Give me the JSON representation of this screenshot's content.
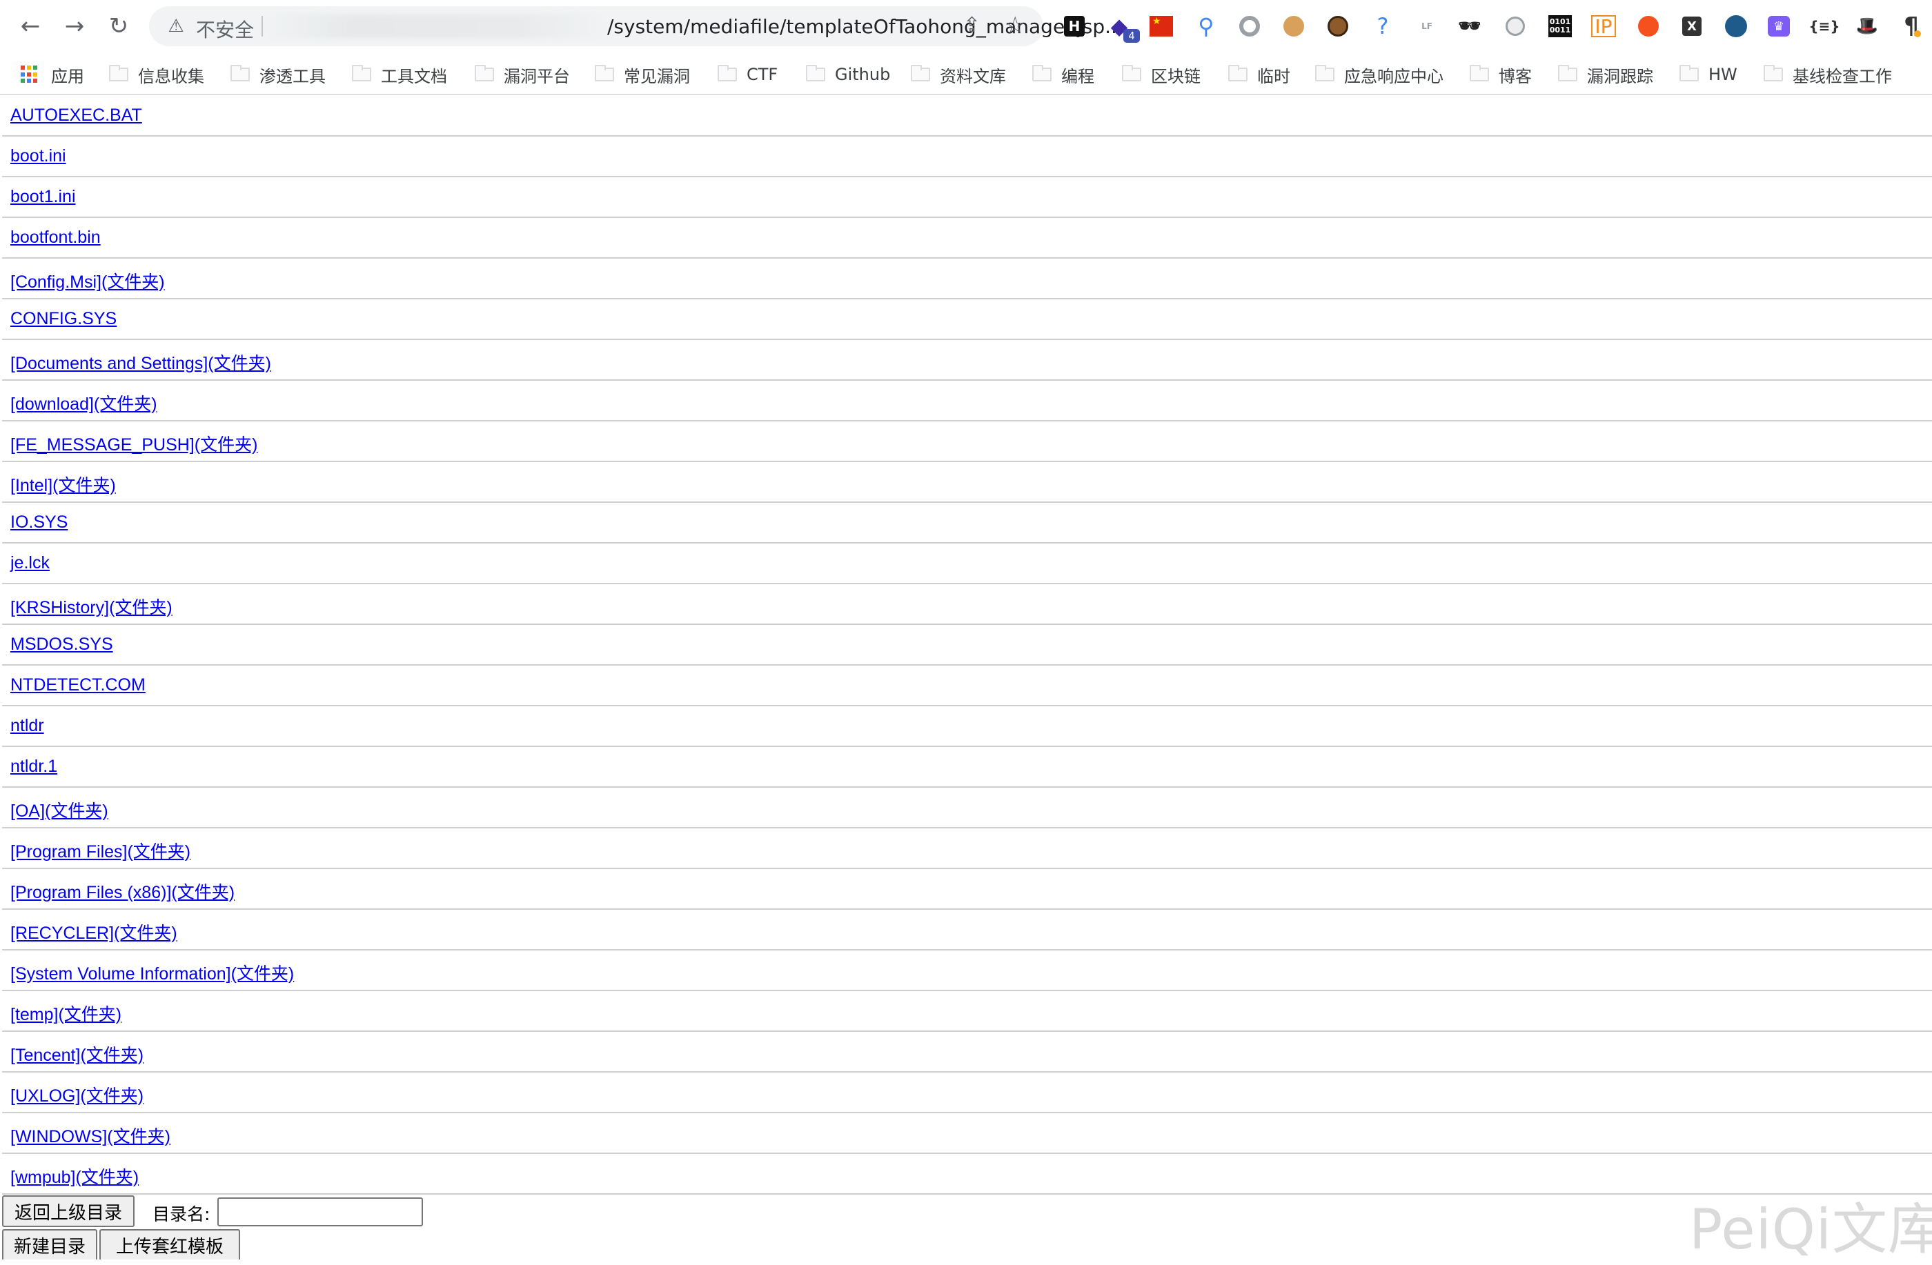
{
  "browser": {
    "back_icon": "arrow-left-icon",
    "forward_icon": "arrow-right-icon",
    "reload_icon": "reload-icon",
    "security_label": "不安全",
    "url_visible": "/system/mediafile/templateOfTaohong_manager.jsp...",
    "share_icon": "share-icon",
    "bookmark_star_icon": "star-icon",
    "extensions": [
      {
        "icon": "h-ext-icon",
        "text": "H"
      },
      {
        "icon": "stack-ext-icon",
        "text": "◆",
        "badge": "4"
      },
      {
        "icon": "china-flag-ext-icon",
        "text": "★"
      },
      {
        "icon": "map-pin-ext-icon",
        "text": "⚲"
      },
      {
        "icon": "gray-circle-ext-icon",
        "text": ""
      },
      {
        "icon": "cookie-ext-icon",
        "text": ""
      },
      {
        "icon": "cookie-dark-ext-icon",
        "text": ""
      },
      {
        "icon": "question-ext-icon",
        "text": "?"
      },
      {
        "icon": "lf-ext-icon",
        "text": "LF"
      },
      {
        "icon": "mask-ext-icon",
        "text": "🕶"
      },
      {
        "icon": "globe-ext-icon",
        "text": ""
      },
      {
        "icon": "binary-ext-icon",
        "text": "0101 0011"
      },
      {
        "icon": "ip-ext-icon",
        "text": "IP"
      },
      {
        "icon": "orange-ext-icon",
        "text": ""
      },
      {
        "icon": "x-ext-icon",
        "text": "X"
      },
      {
        "icon": "blue-ext-icon",
        "text": ""
      },
      {
        "icon": "crown-ext-icon",
        "text": "♛"
      },
      {
        "icon": "braces-ext-icon",
        "text": "{≡}"
      },
      {
        "icon": "hat-ext-icon",
        "text": "🎩"
      },
      {
        "icon": "pilcrow-ext-icon",
        "text": "¶"
      }
    ]
  },
  "bookmarks": {
    "apps_label": "应用",
    "items": [
      "信息收集",
      "渗透工具",
      "工具文档",
      "漏洞平台",
      "常见漏洞",
      "CTF",
      "Github",
      "资料文库",
      "编程",
      "区块链",
      "临时",
      "应急响应中心",
      "博客",
      "漏洞跟踪",
      "HW",
      "基线检查工作"
    ]
  },
  "files": [
    "AUTOEXEC.BAT",
    "boot.ini",
    "boot1.ini",
    "bootfont.bin",
    "[Config.Msi](文件夹)",
    "CONFIG.SYS",
    "[Documents and Settings](文件夹)",
    "[download](文件夹)",
    "[FE_MESSAGE_PUSH](文件夹)",
    "[Intel](文件夹)",
    "IO.SYS",
    "je.lck",
    "[KRSHistory](文件夹)",
    "MSDOS.SYS",
    "NTDETECT.COM",
    "ntldr",
    "ntldr.1",
    "[OA](文件夹)",
    "[Program Files](文件夹)",
    "[Program Files (x86)](文件夹)",
    "[RECYCLER](文件夹)",
    "[System Volume Information](文件夹)",
    "[temp](文件夹)",
    "[Tencent](文件夹)",
    "[UXLOG](文件夹)",
    "[WINDOWS](文件夹)",
    "[wmpub](文件夹)"
  ],
  "form": {
    "back_button": "返回上级目录",
    "dir_name_label": "目录名:",
    "dir_name_value": "",
    "new_dir_button": "新建目录",
    "upload_button": "上传套红模板"
  },
  "watermark": "PeiQi文库"
}
